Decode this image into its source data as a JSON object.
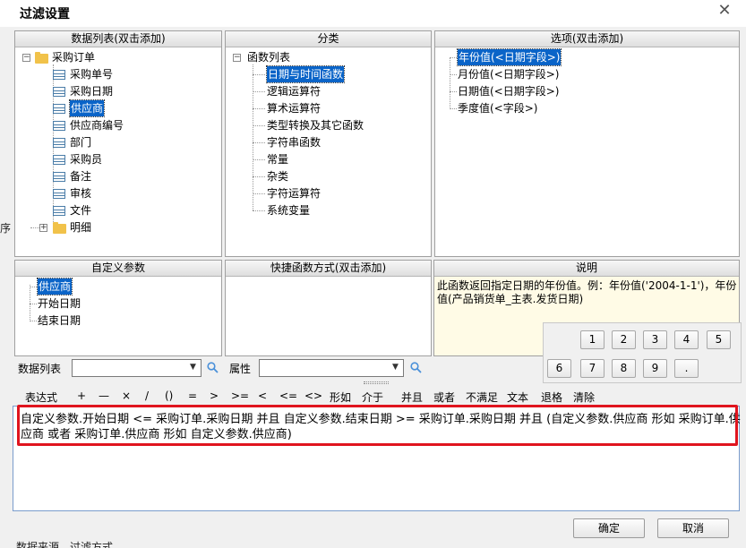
{
  "dialog": {
    "title": "过滤设置",
    "close_glyph": "✕"
  },
  "data_list": {
    "header": "数据列表(双击添加)",
    "root": "采购订单",
    "fields": [
      "采购单号",
      "采购日期",
      "供应商",
      "供应商编号",
      "部门",
      "采购员",
      "备注",
      "审核",
      "文件"
    ],
    "child": "明细"
  },
  "category": {
    "header": "分类",
    "root": "函数列表",
    "items": [
      "日期与时间函数",
      "逻辑运算符",
      "算术运算符",
      "类型转换及其它函数",
      "字符串函数",
      "常量",
      "杂类",
      "字符运算符",
      "系统变量"
    ]
  },
  "options": {
    "header": "选项(双击添加)",
    "items": [
      "年份值(<日期字段>)",
      "月份值(<日期字段>)",
      "日期值(<日期字段>)",
      "季度值(<字段>)"
    ]
  },
  "custom_params": {
    "header": "自定义参数",
    "items": [
      "供应商",
      "开始日期",
      "结束日期"
    ]
  },
  "quick": {
    "header": "快捷函数方式(双击添加)"
  },
  "description": {
    "header": "说明",
    "text": "此函数返回指定日期的年份值。例：年份值('2004-1-1')，年份值(产品销货单_主表.发货日期)"
  },
  "numpad": {
    "keys": [
      "1",
      "2",
      "3",
      "4",
      "5",
      "6",
      "7",
      "8",
      "9",
      "."
    ]
  },
  "filters": {
    "data_list_label": "数据列表",
    "property_label": "属性",
    "data_list_value": "",
    "property_value": ""
  },
  "toolbar": {
    "items": [
      "表达式",
      "+",
      "—",
      "×",
      "/",
      "()",
      "=",
      ">",
      ">=",
      "<",
      "<=",
      "<>",
      "形如",
      "介于",
      "并且",
      "或者",
      "不满足",
      "文本",
      "退格",
      "清除"
    ]
  },
  "expression": {
    "text": "自定义参数.开始日期 <= 采购订单.采购日期 并且 自定义参数.结束日期 >= 采购订单.采购日期 并且 (自定义参数.供应商 形如 采购订单.供应商 或者 采购订单.供应商  形如 自定义参数.供应商)"
  },
  "buttons": {
    "ok": "确定",
    "cancel": "取消"
  },
  "background": {
    "left_stub": "序",
    "bottom_tab1": "数据来源",
    "bottom_tab2": "过滤方式"
  }
}
